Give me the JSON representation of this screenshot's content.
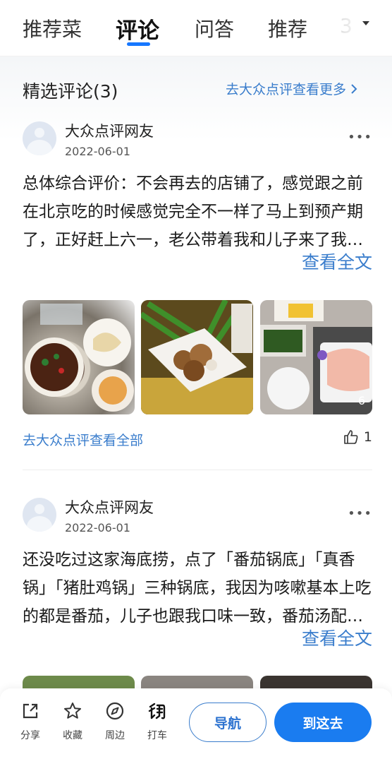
{
  "tabs": [
    {
      "label": "推荐菜",
      "active": false
    },
    {
      "label": "评论",
      "active": true
    },
    {
      "label": "问答",
      "active": false
    },
    {
      "label": "推荐",
      "active": false
    },
    {
      "label": "3",
      "active": false
    }
  ],
  "colors": {
    "accent": "#1677ff",
    "link": "#3a7dcc",
    "primary_button": "#1a7cf0"
  },
  "section": {
    "title": "精选评论(3)",
    "more_link": "去大众点评查看更多",
    "more_link_icon": "chevron-right-icon"
  },
  "reviews": [
    {
      "user": "大众点评网友",
      "date": "2022-06-01",
      "text": "总体综合评价：不会再去的店铺了，感觉跟之前在北京吃的时候感觉完全不一样了马上到预产期了，正好赶上六一，老公带着我和儿子来了我…",
      "view_full": "查看全文",
      "photo_count": "6",
      "source_link": "去大众点评查看全部",
      "likes": "1"
    },
    {
      "user": "大众点评网友",
      "date": "2022-06-01",
      "text": "还没吃过这家海底捞，点了「番茄锅底」「真香锅」「猪肚鸡锅」三种锅底，我因为咳嗽基本上吃的都是番茄，儿子也跟我口味一致，番茄汤配…",
      "view_full": "查看全文"
    }
  ],
  "bottom_bar": {
    "actions": [
      {
        "label": "分享",
        "icon": "share-icon"
      },
      {
        "label": "收藏",
        "icon": "star-icon"
      },
      {
        "label": "周边",
        "icon": "compass-icon"
      },
      {
        "label": "打车",
        "icon": "taxi-icon"
      }
    ],
    "nav_button": "导航",
    "go_button": "到这去"
  }
}
